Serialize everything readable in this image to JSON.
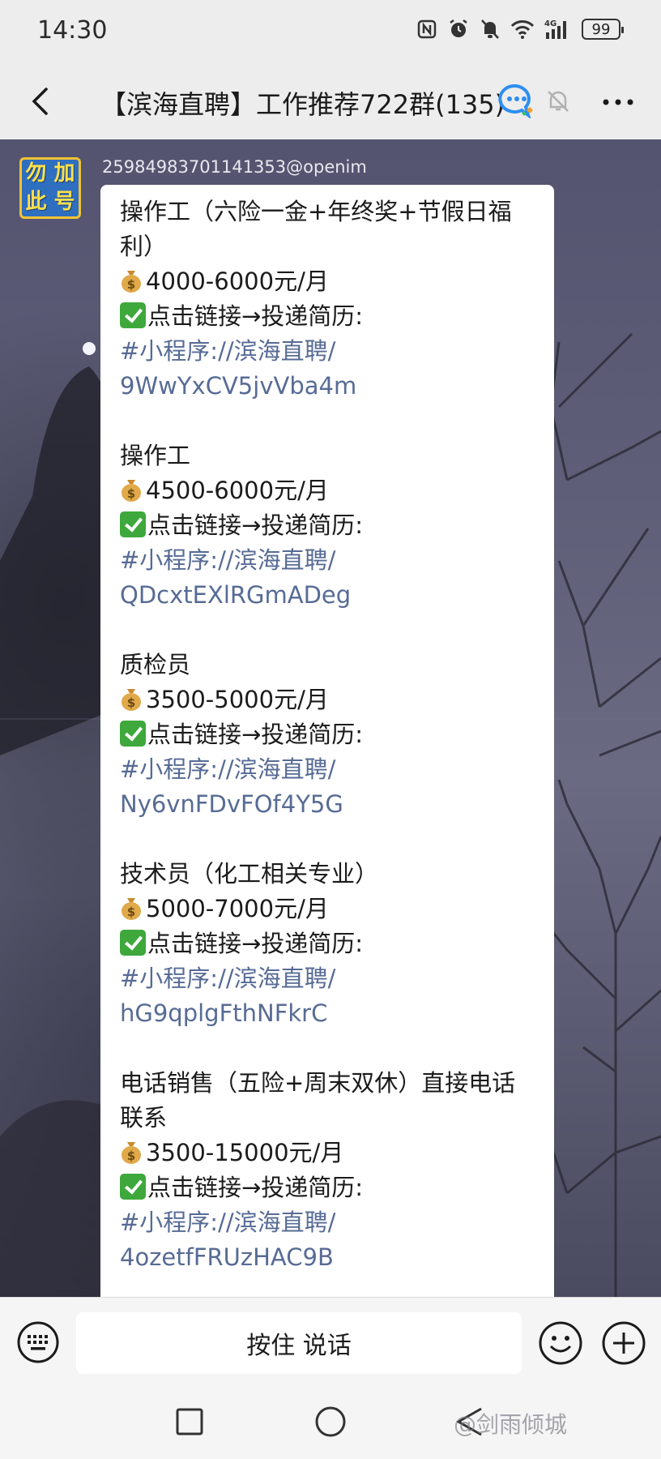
{
  "status_bar": {
    "time": "14:30",
    "battery": "99",
    "icons": [
      "nfc-icon",
      "alarm-icon",
      "mute-bell-icon",
      "wifi-icon",
      "signal-4g-icon",
      "battery-icon"
    ]
  },
  "header": {
    "title": "【滨海直聘】工作推荐722群(135)",
    "icons": [
      "back-icon",
      "chat-bot-icon",
      "mute-icon",
      "more-icon"
    ]
  },
  "message": {
    "avatar_text": [
      "勿",
      "加",
      "此",
      "号"
    ],
    "sender": "2598498370114135​3@openim",
    "jobs": [
      {
        "title": "操作工（六险一金+年终奖+节假日福利）",
        "salary": "4000-6000元/月",
        "apply": "点击链接→投递简历:",
        "link_prefix": "#小程序://滨海直聘/",
        "link_code": "9WwYxCV5jvVba4m"
      },
      {
        "title": "操作工",
        "salary": "4500-6000元/月",
        "apply": "点击链接→投递简历:",
        "link_prefix": "#小程序://滨海直聘/",
        "link_code": "QDcxtEXlRGmADeg"
      },
      {
        "title": "质检员",
        "salary": "3500-5000元/月",
        "apply": "点击链接→投递简历:",
        "link_prefix": "#小程序://滨海直聘/",
        "link_code": "Ny6vnFDvFOf4Y5G"
      },
      {
        "title": "技术员（化工相关专业）",
        "salary": "5000-7000元/月",
        "apply": "点击链接→投递简历:",
        "link_prefix": "#小程序://滨海直聘/",
        "link_code": "hG9qplgFthNFkrC"
      },
      {
        "title": "电话销售（五险+周末双休）直接电话联系",
        "salary": "3500-15000元/月",
        "apply": "点击链接→投递简历:",
        "link_prefix": "#小程序://滨海直聘/",
        "link_code": "4ozetfFRUzHAC9B"
      }
    ]
  },
  "input_bar": {
    "talk_label": "按住 说话",
    "icons": [
      "keyboard-icon",
      "emoji-icon",
      "plus-icon"
    ]
  },
  "nav_bar": {
    "icons": [
      "recent-apps-icon",
      "home-icon",
      "back-nav-icon"
    ],
    "watermark": "@剑雨倾城"
  },
  "colors": {
    "link": "#576b95",
    "bubble": "#ffffff",
    "check_emoji": "#3ea83c"
  }
}
